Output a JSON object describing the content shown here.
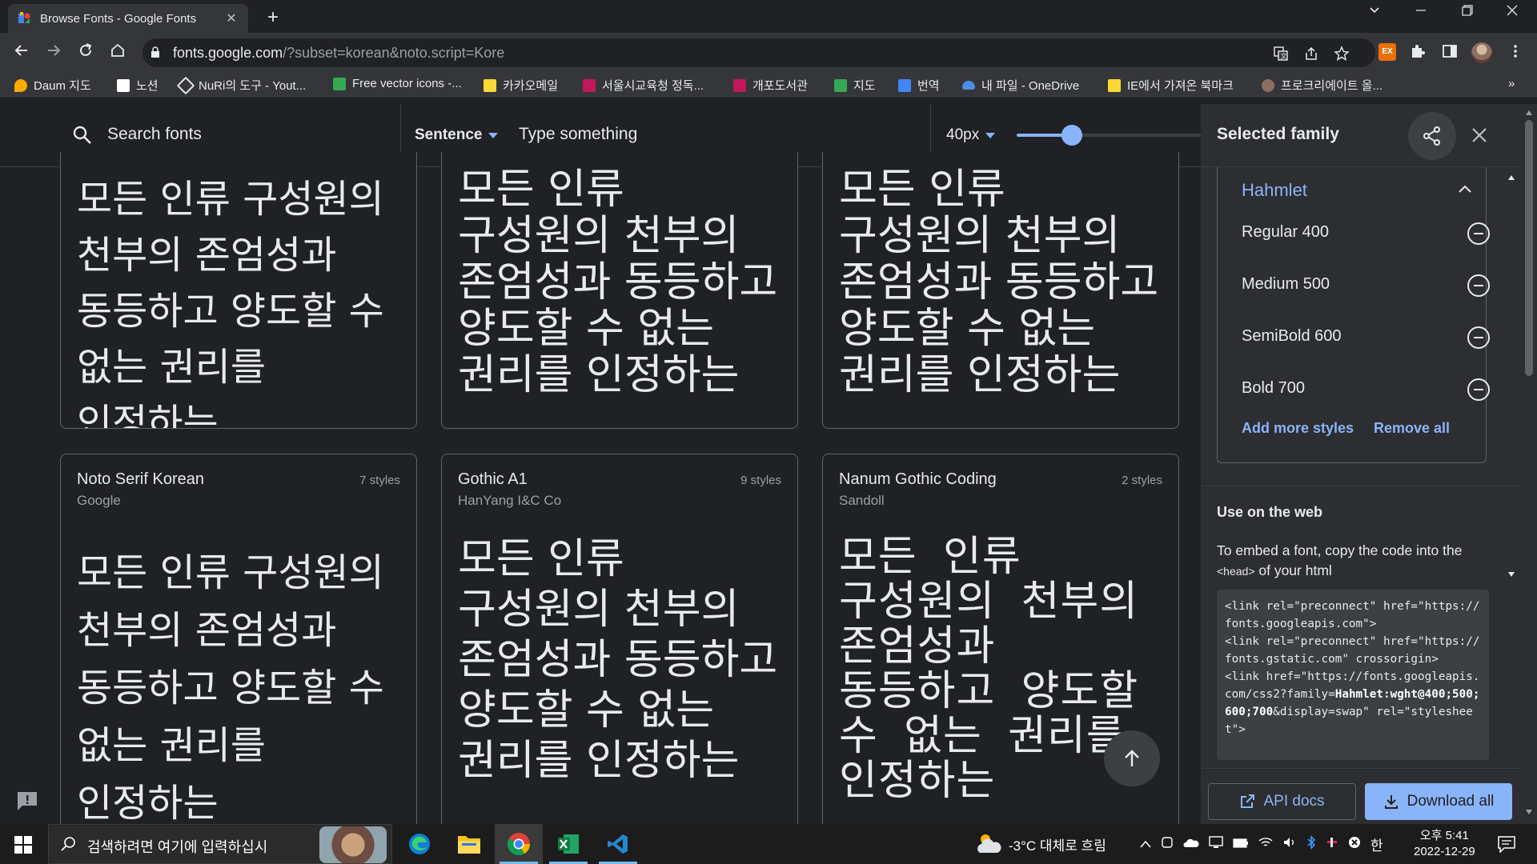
{
  "browser": {
    "tab_title": "Browse Fonts - Google Fonts",
    "new_tab_label": "+",
    "url_host": "fonts.google.com",
    "url_path": "/?subset=korean&noto.script=Kore",
    "bookmarks": [
      {
        "label": "Daum 지도",
        "color": "#f9ab00"
      },
      {
        "label": "노션",
        "color": "#ffffff"
      },
      {
        "label": "NuRi의 도구 - Yout...",
        "color": "#e8eaed"
      },
      {
        "label": "Free vector icons -...",
        "color": "#34a853"
      },
      {
        "label": "카카오메일",
        "color": "#fdd835"
      },
      {
        "label": "서울시교육청 정독...",
        "color": "#c2185b"
      },
      {
        "label": "개포도서관",
        "color": "#c2185b"
      },
      {
        "label": "지도",
        "color": "#34a853"
      },
      {
        "label": "번역",
        "color": "#4285f4"
      },
      {
        "label": "내 파일 - OneDrive",
        "color": "#4a90e2"
      },
      {
        "label": "IE에서 가져온 북마크",
        "color": "#fdd835"
      },
      {
        "label": "프로크리에이트 올...",
        "color": "#8d6e63"
      }
    ],
    "bookmarks_overflow": "»"
  },
  "header": {
    "search_placeholder": "Search fonts",
    "preview_mode": "Sentence",
    "type_placeholder": "Type something",
    "font_size": "40px",
    "font_size_fraction": 0.3
  },
  "sample_text": "모든 인류 구성원의 천부의 존엄성과 동등하고 양도할 수 없는 권리를 인정하는",
  "cards": [
    {
      "name": "",
      "foundry": "",
      "styles": ""
    },
    {
      "name": "",
      "foundry": "",
      "styles": ""
    },
    {
      "name": "",
      "foundry": "",
      "styles": ""
    },
    {
      "name": "Noto Serif Korean",
      "foundry": "Google",
      "styles": "7 styles"
    },
    {
      "name": "Gothic A1",
      "foundry": "HanYang I&C Co",
      "styles": "9 styles"
    },
    {
      "name": "Nanum Gothic Coding",
      "foundry": "Sandoll",
      "styles": "2 styles"
    }
  ],
  "panel": {
    "title": "Selected family",
    "family": "Hahmlet",
    "styles": [
      "Regular 400",
      "Medium 500",
      "SemiBold 600",
      "Bold 700"
    ],
    "add_more": "Add more styles",
    "remove_all": "Remove all",
    "use_on_web": "Use on the web",
    "embed_text_1": "To embed a font, copy the code into the",
    "embed_head": "<head>",
    "embed_text_2": " of your html",
    "code_1": "<link rel=\"preconnect\" href=\"https://fonts.googleapis.com\">",
    "code_2": "<link rel=\"preconnect\" href=\"https://fonts.gstatic.com\" crossorigin>",
    "code_3a": "<link href=\"https://fonts.googleapis.com/css2?family=",
    "code_3b": "Hahmlet:wght@400;500;600;700",
    "code_3c": "&display=swap\" rel=\"stylesheet\">",
    "api_docs": "API docs",
    "download_all": "Download all"
  },
  "taskbar": {
    "search_placeholder": "검색하려면 여기에 입력하십시",
    "weather": "-3°C  대체로 흐림",
    "time": "오후 5:41",
    "date": "2022-12-29",
    "ime": "한"
  },
  "colors": {
    "accent": "#8ab4f8",
    "background": "#202124",
    "panel": "#2d2e31"
  }
}
